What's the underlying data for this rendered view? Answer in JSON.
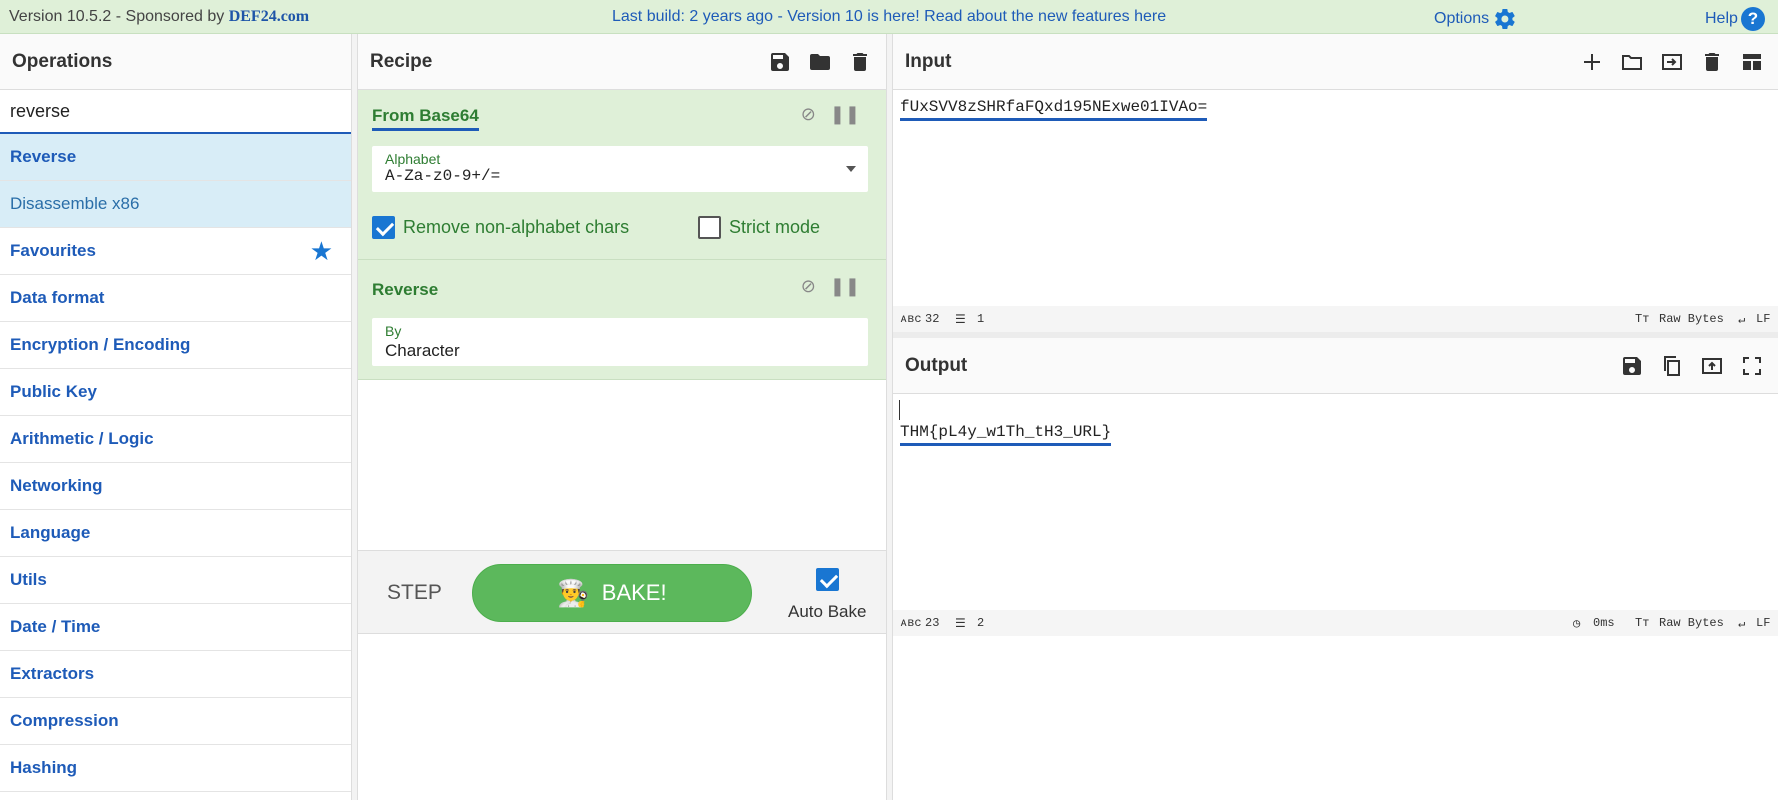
{
  "banner": {
    "version": "Version 10.5.2",
    "sponsor_prefix": " - Sponsored by ",
    "sponsor": "DEF24.com",
    "center": "Last build: 2 years ago - Version 10 is here! Read about the new features here",
    "options": "Options",
    "help": "Help"
  },
  "operations": {
    "title": "Operations",
    "search_value": "reverse",
    "results": [
      "Reverse",
      "Disassemble x86"
    ],
    "categories": [
      "Favourites",
      "Data format",
      "Encryption / Encoding",
      "Public Key",
      "Arithmetic / Logic",
      "Networking",
      "Language",
      "Utils",
      "Date / Time",
      "Extractors",
      "Compression",
      "Hashing"
    ]
  },
  "recipe": {
    "title": "Recipe",
    "ingredients": [
      {
        "name": "From Base64",
        "field_label": "Alphabet",
        "field_value": "A-Za-z0-9+/=",
        "checkbox1": "Remove non-alphabet chars",
        "checkbox2": "Strict mode"
      },
      {
        "name": "Reverse",
        "field_label": "By",
        "field_value": "Character"
      }
    ],
    "step": "STEP",
    "bake": "BAKE!",
    "auto_bake": "Auto Bake"
  },
  "input": {
    "title": "Input",
    "value": "fUxSVV8zSHRfaFQxd195NExwe01IVAo=",
    "chars": "32",
    "lines": "1",
    "encoding": "Raw Bytes",
    "eol": "LF"
  },
  "output": {
    "title": "Output",
    "value": "THM{pL4y_w1Th_tH3_URL}",
    "chars": "23",
    "lines": "2",
    "time": "0ms",
    "encoding": "Raw Bytes",
    "eol": "LF"
  },
  "colors": {
    "banner_bg": "#dff0d8",
    "link_blue": "#1e5bb8",
    "recipe_green": "#2e7d32",
    "bake_green": "#5cb85c"
  }
}
